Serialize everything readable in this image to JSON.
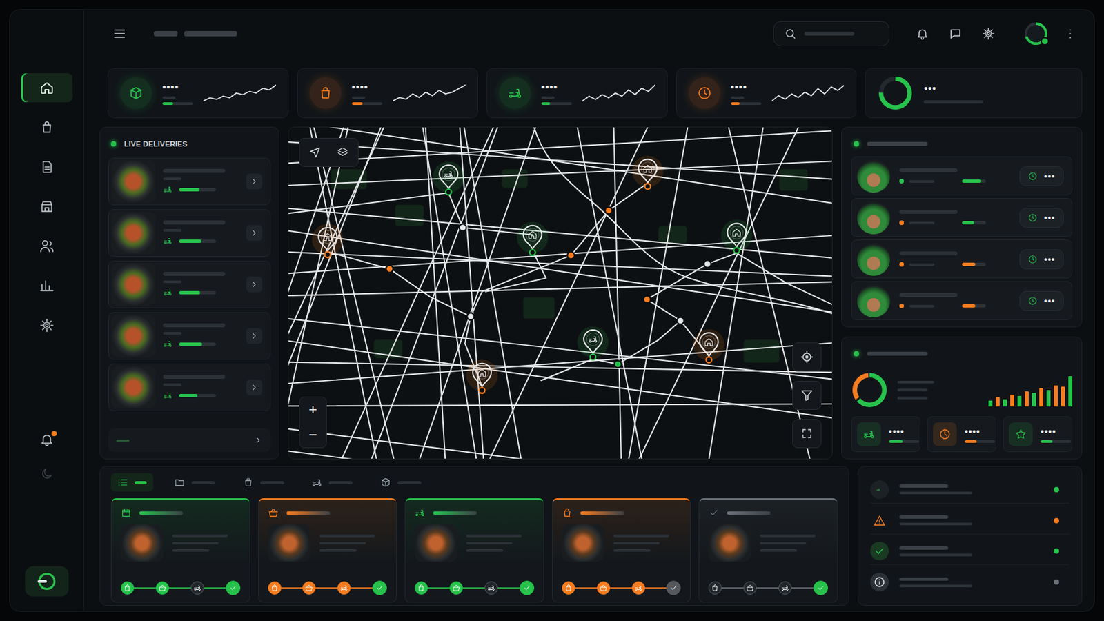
{
  "sidebar": {
    "items": [
      {
        "selected": true
      },
      {
        "selected": false
      },
      {
        "selected": false
      },
      {
        "selected": false
      },
      {
        "selected": false
      },
      {
        "selected": false
      },
      {
        "selected": false
      }
    ],
    "alerts": {
      "unread": true
    },
    "theme_toggle": {
      "on": true
    }
  },
  "topbar": {
    "profile": {
      "online": true,
      "level": 0.7
    }
  },
  "kpis": [
    {
      "kind": "sparkline",
      "value": "••••",
      "color": "#27c24c",
      "level": 0.35,
      "trend": [
        3,
        5,
        4,
        6,
        5,
        8,
        7,
        9,
        8,
        11,
        10,
        13
      ]
    },
    {
      "kind": "sparkline",
      "value": "••••",
      "color": "#f57c1f",
      "level": 0.35,
      "trend": [
        4,
        6,
        5,
        8,
        6,
        9,
        7,
        10,
        8,
        9,
        11,
        13
      ]
    },
    {
      "kind": "sparkline",
      "value": "••••",
      "color": "#27c24c",
      "level": 0.3,
      "trend": [
        3,
        6,
        4,
        7,
        5,
        8,
        6,
        10,
        7,
        11,
        9,
        13
      ]
    },
    {
      "kind": "sparkline",
      "value": "••••",
      "color": "#f57c1f",
      "level": 0.3,
      "trend": [
        4,
        7,
        5,
        8,
        6,
        9,
        7,
        11,
        8,
        12,
        10,
        13
      ]
    },
    {
      "kind": "donut",
      "value": "•••",
      "color": "#27c24c",
      "level": 0.75
    }
  ],
  "live_deliveries": {
    "title": "LIVE DELIVERIES",
    "live": true,
    "items": [
      {
        "level": 0.55
      },
      {
        "level": 0.6
      },
      {
        "level": 0.58
      },
      {
        "level": 0.62
      },
      {
        "level": 0.5
      }
    ]
  },
  "map": {
    "pins": [
      {
        "kind": "rider",
        "color": "#27c24c"
      },
      {
        "kind": "home",
        "color": "#f57c1f"
      },
      {
        "kind": "home",
        "color": "#f57c1f"
      },
      {
        "kind": "home",
        "color": "#27c24c"
      },
      {
        "kind": "home",
        "color": "#27c24c"
      },
      {
        "kind": "rider",
        "color": "#27c24c"
      },
      {
        "kind": "home",
        "color": "#f57c1f"
      },
      {
        "kind": "home",
        "color": "#f57c1f"
      }
    ],
    "routes": [
      {
        "color": "#f57c1f"
      },
      {
        "color": "#f57c1f"
      },
      {
        "color": "#27c24c"
      },
      {
        "color": "#27c24c"
      },
      {
        "color": "#27c24c"
      },
      {
        "color": "#27c24c"
      },
      {
        "color": "#f57c1f"
      }
    ],
    "zoom_in": "+",
    "zoom_out": "−"
  },
  "riders": {
    "live": true,
    "items": [
      {
        "color": "#27c24c",
        "progress_color": "#27c24c",
        "level": 0.8,
        "menu": "•••"
      },
      {
        "color": "#f57c1f",
        "progress_color": "#27c24c",
        "level": 0.5,
        "menu": "•••"
      },
      {
        "color": "#f57c1f",
        "progress_color": "#f57c1f",
        "level": 0.55,
        "menu": "•••"
      },
      {
        "color": "#f57c1f",
        "progress_color": "#f57c1f",
        "level": 0.55,
        "menu": "•••"
      }
    ]
  },
  "stats": {
    "live": true,
    "share": [
      {
        "value": 65,
        "color": "#27c24c"
      },
      {
        "value": 35,
        "color": "#f57c1f"
      }
    ],
    "bars": [
      {
        "value": 8,
        "color": "#27c24c"
      },
      {
        "value": 12,
        "color": "#f57c1f"
      },
      {
        "value": 10,
        "color": "#27c24c"
      },
      {
        "value": 16,
        "color": "#f57c1f"
      },
      {
        "value": 14,
        "color": "#27c24c"
      },
      {
        "value": 20,
        "color": "#f57c1f"
      },
      {
        "value": 18,
        "color": "#27c24c"
      },
      {
        "value": 24,
        "color": "#f57c1f"
      },
      {
        "value": 22,
        "color": "#27c24c"
      },
      {
        "value": 28,
        "color": "#f57c1f"
      },
      {
        "value": 26,
        "color": "#f57c1f"
      },
      {
        "value": 40,
        "color": "#27c24c"
      }
    ],
    "cards": [
      {
        "value": "••••",
        "color": "#27c24c",
        "level": 0.45
      },
      {
        "value": "••••",
        "color": "#f57c1f",
        "level": 0.4
      },
      {
        "value": "••••",
        "color": "#27c24c",
        "level": 0.4
      }
    ]
  },
  "orders": {
    "tabs": [
      {
        "selected": true
      },
      {
        "selected": false
      },
      {
        "selected": false
      },
      {
        "selected": false
      },
      {
        "selected": false
      }
    ],
    "cards": [
      {
        "color": "#27c24c",
        "steps": [
          {
            "done": true
          },
          {
            "done": true
          },
          {
            "done": false
          }
        ],
        "finished": true
      },
      {
        "color": "#f57c1f",
        "steps": [
          {
            "done": true
          },
          {
            "done": true
          },
          {
            "done": true
          }
        ],
        "finished": true
      },
      {
        "color": "#27c24c",
        "steps": [
          {
            "done": true
          },
          {
            "done": true
          },
          {
            "done": false
          }
        ],
        "finished": true
      },
      {
        "color": "#f57c1f",
        "steps": [
          {
            "done": true
          },
          {
            "done": true
          },
          {
            "done": true
          }
        ],
        "finished": false
      },
      {
        "color": "#6b7178",
        "steps": [
          {
            "done": false
          },
          {
            "done": false
          },
          {
            "done": false
          }
        ],
        "finished": true
      }
    ]
  },
  "activity": [
    {
      "kind": "rider",
      "color": "#27c24c"
    },
    {
      "kind": "warning",
      "color": "#f57c1f"
    },
    {
      "kind": "success",
      "color": "#27c24c"
    },
    {
      "kind": "info",
      "color": "#6b7178"
    }
  ]
}
